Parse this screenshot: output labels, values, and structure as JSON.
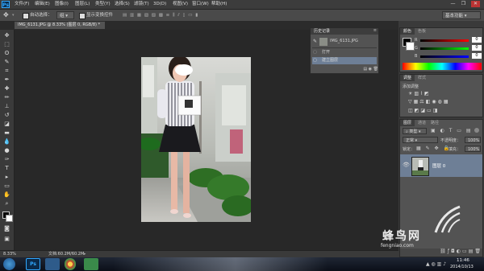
{
  "app": {
    "logo_text": "Ps"
  },
  "menu": [
    "文件(F)",
    "编辑(E)",
    "图像(I)",
    "图层(L)",
    "类型(Y)",
    "选择(S)",
    "滤镜(T)",
    "3D(D)",
    "视图(V)",
    "窗口(W)",
    "帮助(H)"
  ],
  "window_controls": {
    "minimize": "—",
    "restore": "❐",
    "close": "✕"
  },
  "options": {
    "auto_select_label": "自动选择：",
    "auto_select_value": "组",
    "show_transform_label": "显示变换控件",
    "workspace": "基本功能"
  },
  "document_tab": {
    "title": "IMG_6131.JPG @ 8.33% (图层 0, RGB/8) *",
    "close": "×"
  },
  "status": {
    "zoom": "8.33%",
    "doc_info": "文档:60.2M/60.2M"
  },
  "history_panel": {
    "tab": "历史记录",
    "snapshot_name": "IMG_6131.JPG",
    "items": [
      {
        "label": "打开"
      },
      {
        "label": "建立图层"
      }
    ]
  },
  "color_panel": {
    "tabs": [
      "颜色",
      "色板"
    ],
    "sliders": [
      {
        "label": "R",
        "value": "0"
      },
      {
        "label": "G",
        "value": "0"
      },
      {
        "label": "B",
        "value": "0"
      }
    ]
  },
  "adjustments_panel": {
    "tabs": [
      "调整",
      "样式"
    ],
    "title": "添加调整"
  },
  "layers_panel": {
    "tabs": [
      "图层",
      "通道",
      "路径"
    ],
    "kind_label": "类型",
    "blend_mode": "正常",
    "opacity_label": "不透明度：",
    "opacity_value": "100%",
    "lock_label": "锁定：",
    "fill_label": "填充：",
    "fill_value": "100%",
    "layer_name": "图层 0"
  },
  "taskbar": {
    "time": "11:46",
    "date": "2014/10/13"
  },
  "watermark": {
    "brand": "蜂鸟网",
    "url": "fengniao.com"
  },
  "colors": {
    "accent": "#31a8ff",
    "selected_row": "#6e7f96",
    "panel_bg": "#535353"
  }
}
